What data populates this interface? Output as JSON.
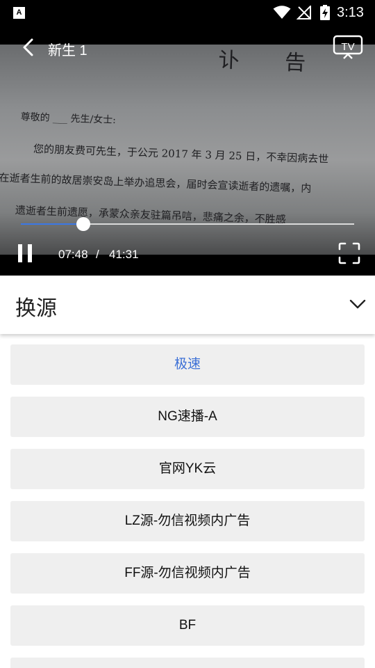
{
  "status_bar": {
    "app_badge": "A",
    "time": "3:13"
  },
  "player": {
    "title": "新生 1",
    "progress_fraction": 0.188,
    "current_time": "07:48",
    "separator": "/",
    "total_time": "41:31",
    "cast_label": "TV",
    "frame_text": {
      "heading": "讣 告",
      "line1": "尊敬的 ___ 先生/女士:",
      "line2": "您的朋友费可先生，于公元  2017 年 3 月 25 日，不幸因病去世",
      "line3": "在逝者生前的故居崇安岛上举办追思会，届时会宣读逝者的遗嘱，内",
      "line4": "遗逝者生前遗愿，承蒙众亲友驻篇吊唁，悲痛之余，不胜感"
    }
  },
  "panel": {
    "title": "换源",
    "sources": [
      {
        "label": "极速",
        "active": true
      },
      {
        "label": "NG速播-A",
        "active": false
      },
      {
        "label": "官网YK云",
        "active": false
      },
      {
        "label": "LZ源-勿信视频内广告",
        "active": false
      },
      {
        "label": "FF源-勿信视频内广告",
        "active": false
      },
      {
        "label": "BF",
        "active": false
      },
      {
        "label": "",
        "active": false
      }
    ]
  },
  "colors": {
    "accent": "#3b78e7",
    "active_source_text": "#3b6fd6",
    "item_background": "#efefef"
  }
}
